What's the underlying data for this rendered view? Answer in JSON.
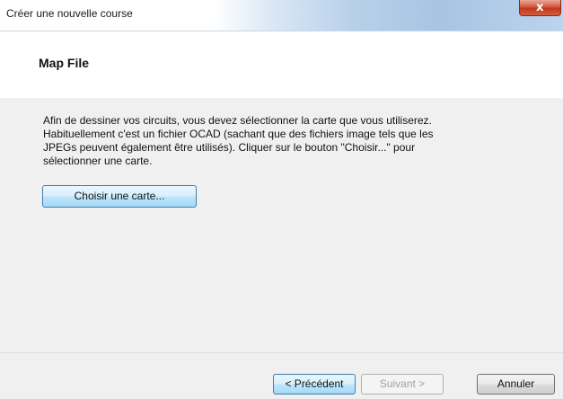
{
  "window": {
    "title": "Créer une nouvelle course",
    "close_glyph": "x"
  },
  "header": {
    "title": "Map File"
  },
  "content": {
    "instructions": "Afin de dessiner vos circuits, vous devez sélectionner la carte que vous utiliserez.\nHabituellement c'est un fichier OCAD (sachant que des fichiers image tels que les\nJPEGs peuvent également être utilisés). Cliquer sur le bouton \"Choisir...\" pour\nsélectionner une carte.",
    "choose_button_label": "Choisir une carte..."
  },
  "footer": {
    "back_label": "< Précédent",
    "next_label": "Suivant >",
    "cancel_label": "Annuler"
  }
}
